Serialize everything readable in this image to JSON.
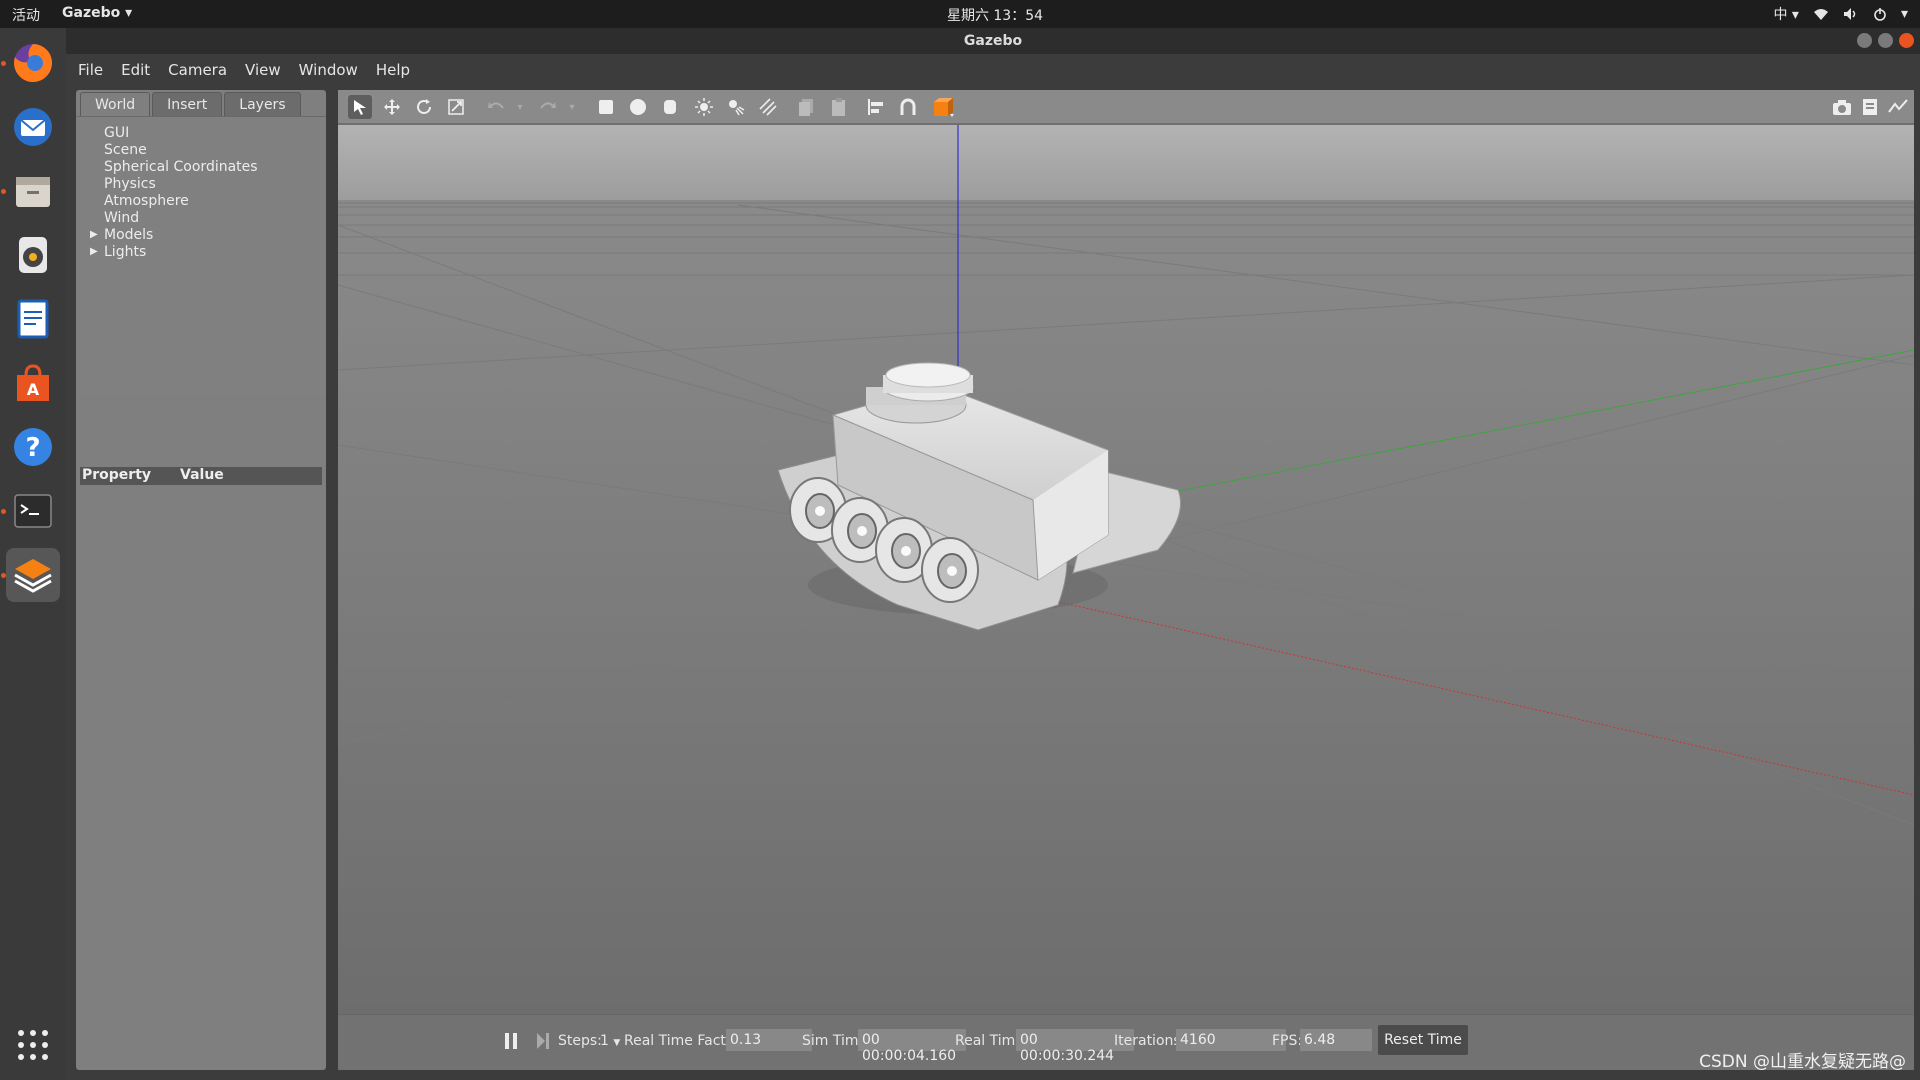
{
  "topbar": {
    "activities": "活动",
    "app_menu": "Gazebo",
    "clock": "星期六 13：54",
    "input_method": "中"
  },
  "dock": {
    "items": [
      {
        "name": "firefox",
        "icon": "firefox-icon"
      },
      {
        "name": "thunderbird",
        "icon": "mail-icon"
      },
      {
        "name": "files",
        "icon": "files-icon"
      },
      {
        "name": "rhythmbox",
        "icon": "music-icon"
      },
      {
        "name": "writer",
        "icon": "document-icon"
      },
      {
        "name": "software",
        "icon": "store-icon"
      },
      {
        "name": "help",
        "icon": "help-icon"
      },
      {
        "name": "terminal",
        "icon": "terminal-icon"
      },
      {
        "name": "gazebo",
        "icon": "gazebo-icon"
      }
    ],
    "show_apps_icon": "apps-grid-icon"
  },
  "window": {
    "title": "Gazebo"
  },
  "menubar": {
    "items": [
      "File",
      "Edit",
      "Camera",
      "View",
      "Window",
      "Help"
    ]
  },
  "left_panel": {
    "tabs": [
      "World",
      "Insert",
      "Layers"
    ],
    "selected_tab": "World",
    "tree": [
      "GUI",
      "Scene",
      "Spherical Coordinates",
      "Physics",
      "Atmosphere",
      "Wind",
      "Models",
      "Lights"
    ],
    "property_header": {
      "property": "Property",
      "value": "Value"
    }
  },
  "toolbar": {
    "icons": [
      "select-arrow-icon",
      "translate-icon",
      "rotate-icon",
      "scale-icon",
      "undo-icon",
      "undo-dropdown-icon",
      "redo-icon",
      "redo-dropdown-icon",
      "box-icon",
      "sphere-icon",
      "cylinder-icon",
      "point-light-icon",
      "spot-light-icon",
      "directional-light-icon",
      "copy-icon",
      "paste-icon",
      "align-icon",
      "snap-icon",
      "view-angle-icon"
    ],
    "right_icons": [
      "screenshot-icon",
      "log-icon",
      "plot-icon",
      "record-icon"
    ]
  },
  "bottom_bar": {
    "steps_label": "Steps:",
    "steps_value": "1",
    "rtf_label": "Real Time Factor:",
    "rtf_value": "0.13",
    "sim_time_label": "Sim Time:",
    "sim_time_value": "00 00:00:04.160",
    "real_time_label": "Real Time:",
    "real_time_value": "00 00:00:30.244",
    "iterations_label": "Iterations:",
    "iterations_value": "4160",
    "fps_label": "FPS:",
    "fps_value": "6.48",
    "reset_label": "Reset Time"
  },
  "watermark": "CSDN @山重水复疑无路@"
}
